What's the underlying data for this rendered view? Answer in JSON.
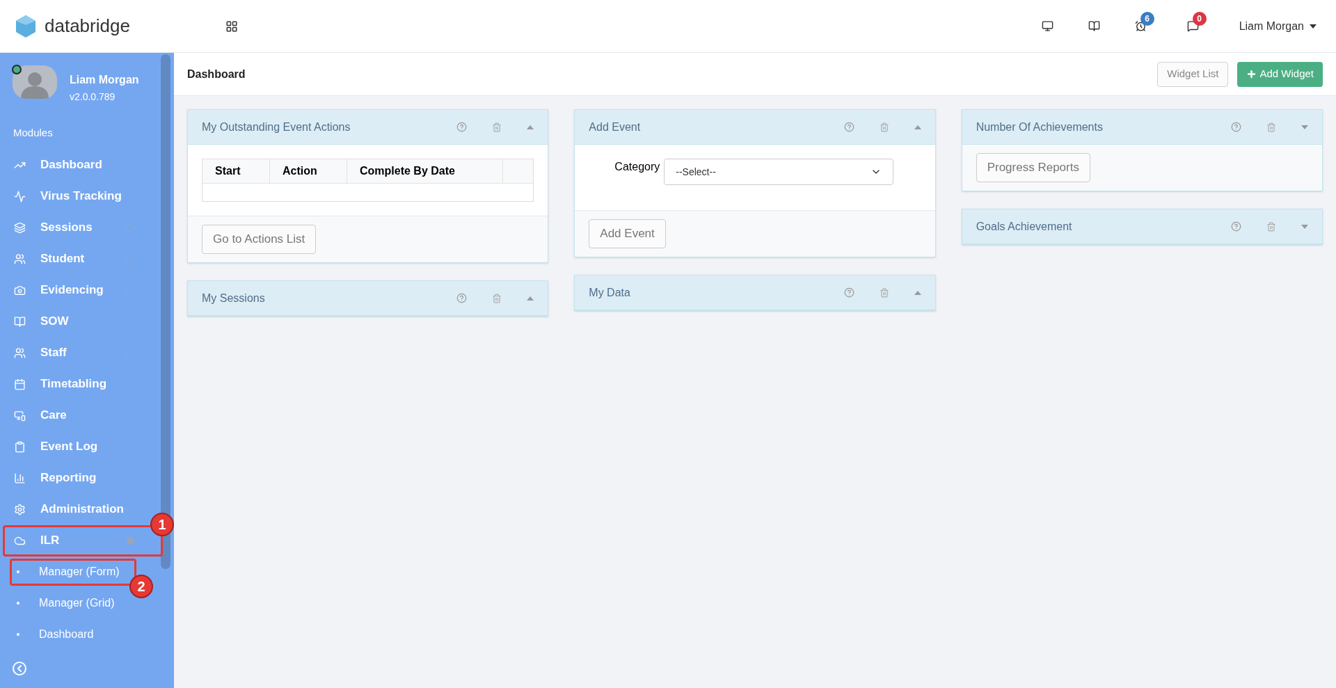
{
  "topbar": {
    "brand": "databridge",
    "badges": [
      {
        "kind": "alarm",
        "count": "6",
        "color": "#3b7dc4"
      },
      {
        "kind": "chat",
        "count": "0",
        "color": "#dc3545"
      }
    ],
    "user": "Liam Morgan"
  },
  "sidebar": {
    "profile": {
      "name": "Liam Morgan",
      "version": "v2.0.0.789",
      "online": true
    },
    "section": "Modules",
    "items": [
      {
        "label": "Dashboard",
        "kind": "link"
      },
      {
        "label": "Virus Tracking",
        "kind": "link"
      },
      {
        "label": "Sessions",
        "kind": "group",
        "expanded": false
      },
      {
        "label": "Student",
        "kind": "group",
        "expanded": false
      },
      {
        "label": "Evidencing",
        "kind": "group",
        "expanded": false
      },
      {
        "label": "SOW",
        "kind": "link"
      },
      {
        "label": "Staff",
        "kind": "group",
        "expanded": false
      },
      {
        "label": "Timetabling",
        "kind": "group",
        "expanded": false
      },
      {
        "label": "Care",
        "kind": "group",
        "expanded": false
      },
      {
        "label": "Event Log",
        "kind": "group",
        "expanded": false
      },
      {
        "label": "Reporting",
        "kind": "group",
        "expanded": false
      },
      {
        "label": "Administration",
        "kind": "group",
        "expanded": false
      },
      {
        "label": "ILR",
        "kind": "group",
        "expanded": true,
        "annotation": "1",
        "children": [
          {
            "label": "Manager (Form)",
            "annotation": "2"
          },
          {
            "label": "Manager (Grid)"
          },
          {
            "label": "Dashboard"
          }
        ]
      }
    ]
  },
  "page": {
    "title": "Dashboard",
    "buttons": [
      {
        "label": "Widget List",
        "kind": "default"
      },
      {
        "label": "Add Widget",
        "kind": "primary"
      }
    ]
  },
  "columns": [
    [
      {
        "title": "My Outstanding Event Actions",
        "expanded": true,
        "body": {
          "kind": "table",
          "columns": [
            "Start",
            "Action",
            "Complete By Date"
          ]
        },
        "footer": "Go to Actions List"
      },
      {
        "title": "My Sessions",
        "expanded": true
      }
    ],
    [
      {
        "title": "Add Event",
        "expanded": true,
        "body": {
          "kind": "form",
          "label": "Category",
          "placeholder": "--Select--"
        },
        "footer": "Add Event"
      },
      {
        "title": "My Data",
        "expanded": true
      }
    ],
    [
      {
        "title": "Number Of Achievements",
        "expanded": false,
        "footer": "Progress Reports"
      },
      {
        "title": "Goals Achievement",
        "expanded": false
      }
    ]
  ]
}
